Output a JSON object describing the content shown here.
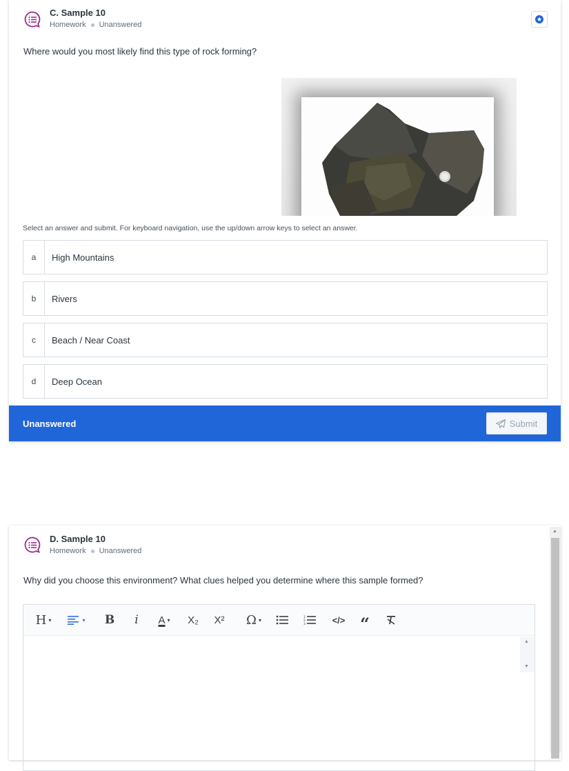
{
  "question1": {
    "title": "C. Sample 10",
    "meta_type": "Homework",
    "meta_status": "Unanswered",
    "prompt": "Where would you most likely find this type of rock forming?",
    "instruction": "Select an answer and submit. For keyboard navigation, use the up/down arrow keys to select an answer.",
    "choices": [
      {
        "letter": "a",
        "text": "High Mountains"
      },
      {
        "letter": "b",
        "text": "Rivers"
      },
      {
        "letter": "c",
        "text": "Beach / Near  Coast"
      },
      {
        "letter": "d",
        "text": "Deep Ocean"
      }
    ],
    "status_label": "Unanswered",
    "submit_label": "Submit"
  },
  "question2": {
    "title": "D. Sample 10",
    "meta_type": "Homework",
    "meta_status": "Unanswered",
    "prompt": "Why did you choose this environment? What clues helped you determine where this sample formed?",
    "toolbar": {
      "heading": "H",
      "bold": "B",
      "italic": "i",
      "font_color": "A",
      "subscript": "X₂",
      "superscript": "X²",
      "special_char": "Ω",
      "code": "</>",
      "quote": "“"
    }
  },
  "icons": {
    "question": "question-bubble-icon",
    "bookmark": "star-badge-icon",
    "submit": "paper-plane-icon"
  },
  "colors": {
    "accent": "#2066d8",
    "icon_purple": "#9b2c8f"
  }
}
